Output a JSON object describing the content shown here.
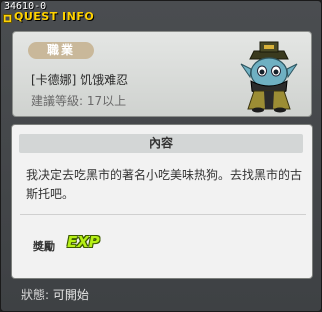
{
  "window": {
    "quest_id": "34610-0",
    "title": "QUEST INFO"
  },
  "job": {
    "badge": "職業",
    "name": "[卡德娜] 饥饿难忍",
    "level_requirement": "建議等級: 17以上",
    "character_icon": "masked-ninja-character"
  },
  "content": {
    "header": "內容",
    "description": "我决定去吃黑市的著名小吃美味热狗。去找黑市的古斯托吧。",
    "reward_label": "獎勵",
    "reward_badge": "EXP"
  },
  "status": {
    "label": "狀態:",
    "value": "可開始"
  },
  "colors": {
    "title": "#ffd200",
    "exp": "#b6f016"
  }
}
